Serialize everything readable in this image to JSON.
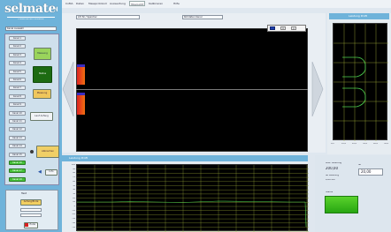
{
  "logo": {
    "name": "selmatec",
    "claim": "measurement software"
  },
  "menu": [
    {
      "label": "CoMA",
      "active": false
    },
    {
      "label": "Daten",
      "active": false
    },
    {
      "label": "Messprotokoll",
      "active": false
    },
    {
      "label": "Auswertung",
      "active": false
    },
    {
      "label": "Übersicht",
      "active": true
    },
    {
      "label": "Kalibrieren",
      "active": false
    },
    {
      "label": "Hilfe",
      "active": false
    }
  ],
  "left": {
    "selection_label": "Kanal Auswahl",
    "channels": [
      "Kanal 1",
      "Kanal 2",
      "Kanal 3",
      "Kanal 4",
      "Kanal 5",
      "Kanal 6",
      "Kanal 7",
      "Kanal 8",
      "Kanal 9",
      "Kanal 10",
      "Kanal 11",
      "Kanal 12",
      "Kanal 13",
      "Kanal 14",
      "Kanal 15",
      "Kanal 16",
      "Kanal 17",
      "Kanal 18"
    ],
    "btn_messung1": "Messung",
    "btn_status": "Status",
    "btn_messung2": "Messung",
    "btn_lauf": "Lauf Anfang",
    "btn_abbrechen": "Abbrechen",
    "btn_mini": "Info",
    "bottom_title": "Test",
    "btn_start_end": "Anfang/Ende",
    "btn_ende": "Ende"
  },
  "main": {
    "field1": "Lfd Nr / Speicher",
    "field2": "Rohdaten Kanal",
    "toolbox": [
      "x",
      "y"
    ]
  },
  "right_top": {
    "title": "Leistung Profil",
    "ticks": [
      "0,0",
      "10,0",
      "20,0",
      "30,0",
      "40,0",
      "50,0"
    ]
  },
  "bottom_main": {
    "title": "Leistung Profil",
    "ticks": [
      "100",
      "90",
      "80",
      "70",
      "60",
      "50",
      "40",
      "30",
      "20",
      "10",
      "0",
      "-10",
      "-20",
      "-30",
      "-40",
      "-50"
    ]
  },
  "bottom_right": {
    "label1": "Max. Leistung",
    "value1": "200,00",
    "label2": "Ist",
    "value2": "20,00",
    "label3": "Ist Leistung",
    "value3": "0,00 kW",
    "status_label": "Status"
  },
  "colors": {
    "panel_blue": "#6fb3da",
    "trace_green": "#4fd24f",
    "grid_yellow": "#b8c840",
    "status_green": "#3fc21f"
  }
}
